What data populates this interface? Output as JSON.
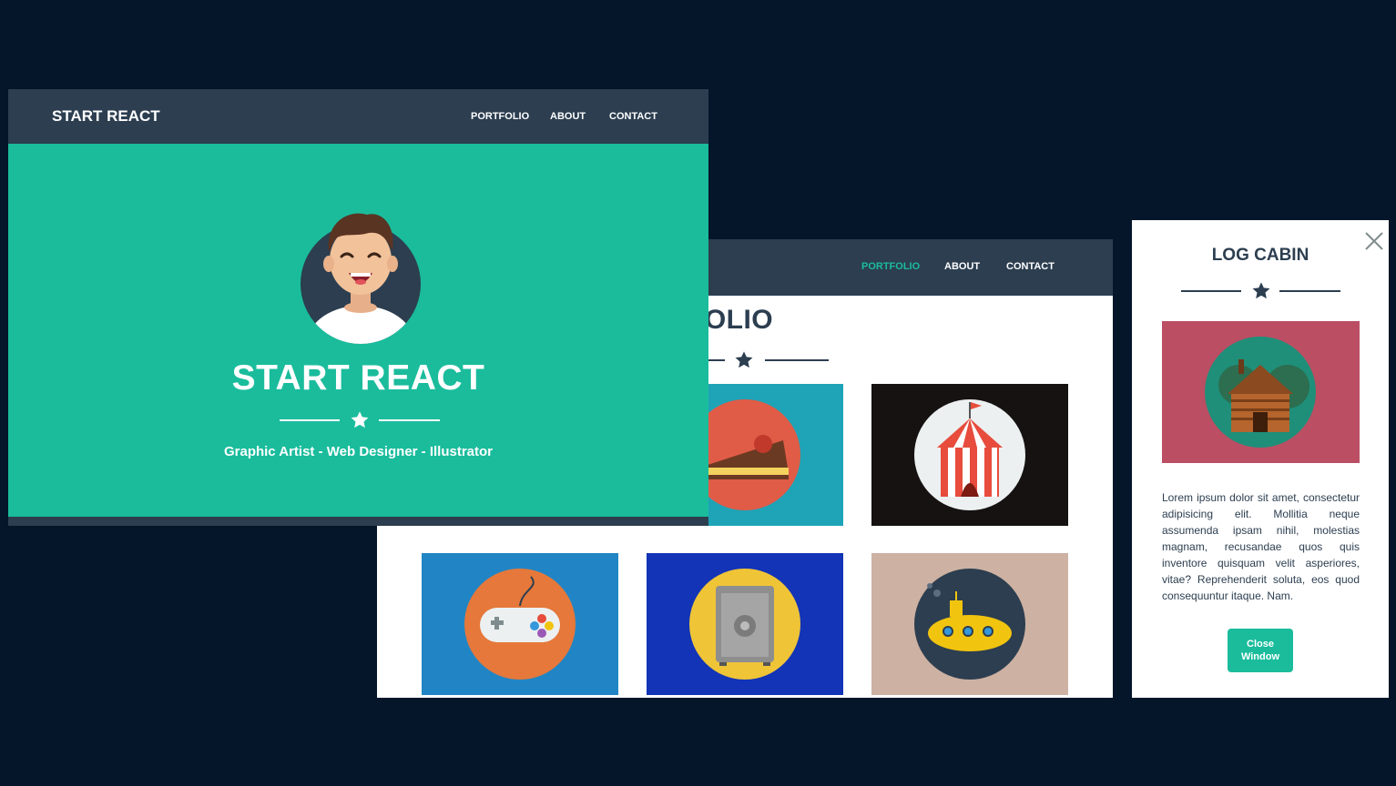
{
  "landing": {
    "brand": "START REACT",
    "nav": [
      "PORTFOLIO",
      "ABOUT",
      "CONTACT"
    ],
    "hero_title": "START REACT",
    "hero_subtitle": "Graphic Artist - Web Designer - Illustrator"
  },
  "portfolio": {
    "nav": [
      "PORTFOLIO",
      "ABOUT",
      "CONTACT"
    ],
    "active_nav": "PORTFOLIO",
    "heading_visible": "RTFOLIO",
    "tiles": [
      {
        "name": "cake",
        "bg": "#1fa3b7",
        "circle": "#e05c47"
      },
      {
        "name": "circus",
        "bg": "#161212",
        "circle": "#ecf0f1"
      },
      {
        "name": "game",
        "bg": "#2185c5",
        "circle": "#e5783a"
      },
      {
        "name": "safe",
        "bg": "#1334b7",
        "circle": "#efc437"
      },
      {
        "name": "submarine",
        "bg": "#cdb1a2",
        "circle": "#2c3e50"
      }
    ]
  },
  "modal": {
    "title": "LOG CABIN",
    "description": "Lorem ipsum dolor sit amet, consectetur adipisicing elit. Mollitia neque assumenda ipsam nihil, molestias magnam, recusandae quos quis inventore quisquam velit asperiores, vitae? Reprehenderit soluta, eos quod consequuntur itaque. Nam.",
    "close_button": "Close Window",
    "image_bg": "#bb4e63"
  },
  "colors": {
    "background": "#05162a",
    "navbar": "#2c3e50",
    "accent": "#1abc9c",
    "text_dark": "#2c3e50"
  }
}
